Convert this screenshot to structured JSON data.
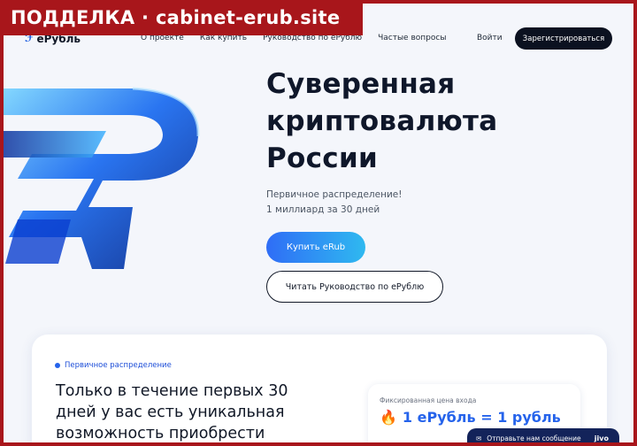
{
  "warning_banner": "ПОДДЕЛКА · cabinet-erub.site",
  "header": {
    "logo_text": "еРубль",
    "nav": [
      "О проекте",
      "Как купить",
      "Руководство по еРублю",
      "Частые вопросы"
    ],
    "login": "Войти",
    "register": "Зарегистрироваться"
  },
  "hero": {
    "title_lines": [
      "Суверенная",
      "криптовалюта",
      "России"
    ],
    "subtitle_lines": [
      "Первичное распределение!",
      "1 миллиард за 30 дней"
    ],
    "buy_button": "Купить eRub",
    "guide_button": "Читать Руководство по еРублю"
  },
  "card": {
    "badge": "Первичное распределение",
    "text_lines": [
      "Только в течение первых 30",
      "дней у вас есть уникальная",
      "возможность приобрести"
    ],
    "price_label": "Фиксированная цена входа",
    "price_value": "1 еРубль = 1 рубль"
  },
  "chat": {
    "label": "Отправьте нам сообщение",
    "brand": "jivo"
  },
  "colors": {
    "accent": "#2563eb",
    "warning": "#a8161b",
    "dark_button": "#0b1120"
  }
}
